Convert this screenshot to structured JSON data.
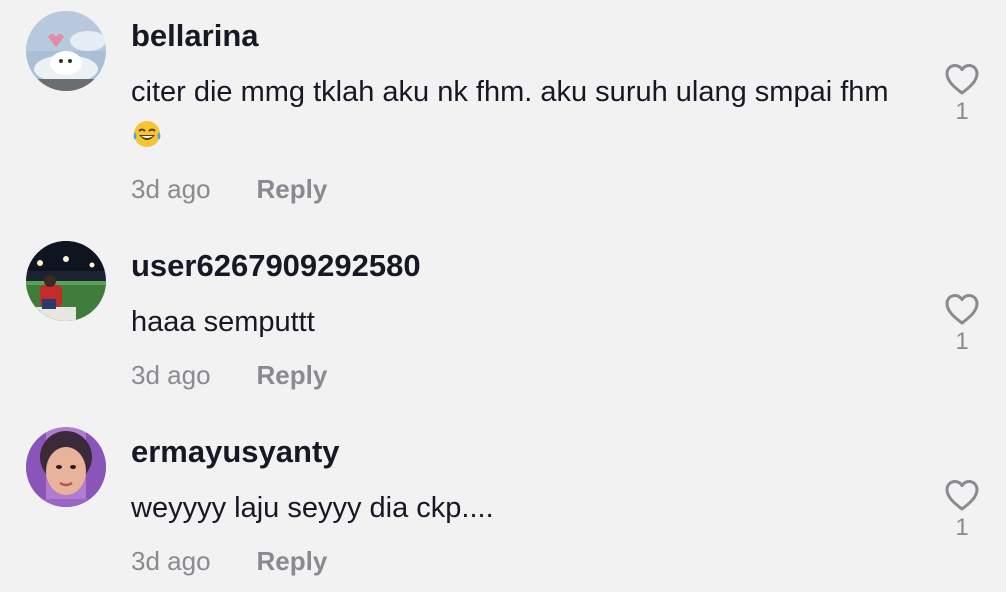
{
  "comments": [
    {
      "username": "bellarina",
      "text": "citer die mmg tklah aku nk fhm. aku suruh ulang smpai fhm",
      "emoji": "face-with-tears-of-joy",
      "time": "3d ago",
      "reply_label": "Reply",
      "likes": "1"
    },
    {
      "username": "user6267909292580",
      "text": "haaa semputtt",
      "time": "3d ago",
      "reply_label": "Reply",
      "likes": "1"
    },
    {
      "username": "ermayusyanty",
      "text": "weyyyy laju seyyy dia ckp....",
      "time": "3d ago",
      "reply_label": "Reply",
      "likes": "1"
    }
  ],
  "colors": {
    "background": "#f2f2f2",
    "username": "#161823",
    "secondary": "#8a8b91"
  },
  "icons": [
    "heart-outline-icon"
  ]
}
